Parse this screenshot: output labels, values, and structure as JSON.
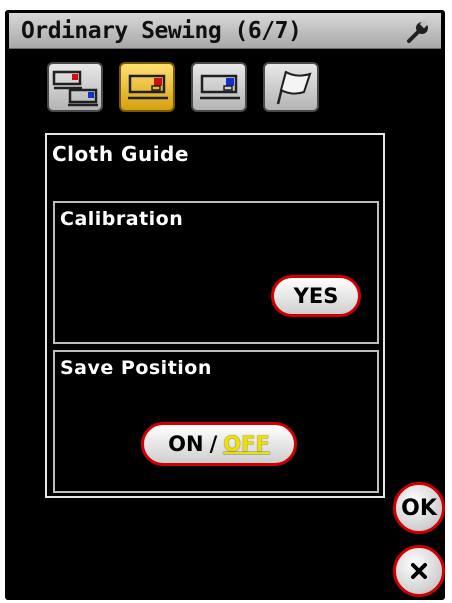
{
  "header": {
    "title": "Ordinary Sewing (6/7)",
    "settings_icon": "wrench-icon"
  },
  "tabs": [
    {
      "icon": "sewing-machine-multi-icon",
      "active": false
    },
    {
      "icon": "sewing-machine-red-icon",
      "active": true
    },
    {
      "icon": "sewing-machine-blue-icon",
      "active": false
    },
    {
      "icon": "flag-icon",
      "active": false
    }
  ],
  "cloth_guide": {
    "title": "Cloth Guide",
    "calibration": {
      "label": "Calibration",
      "button_label": "YES"
    },
    "save_position": {
      "label": "Save Position",
      "on_label": "ON",
      "separator": "/",
      "off_label": "OFF",
      "selected": "OFF"
    }
  },
  "actions": {
    "ok_label": "OK",
    "close_icon": "close-icon"
  },
  "colors": {
    "background": "#000000",
    "accent_red": "#d00000",
    "selected_yellow": "#f0e000",
    "active_tab": "#f0c020"
  }
}
